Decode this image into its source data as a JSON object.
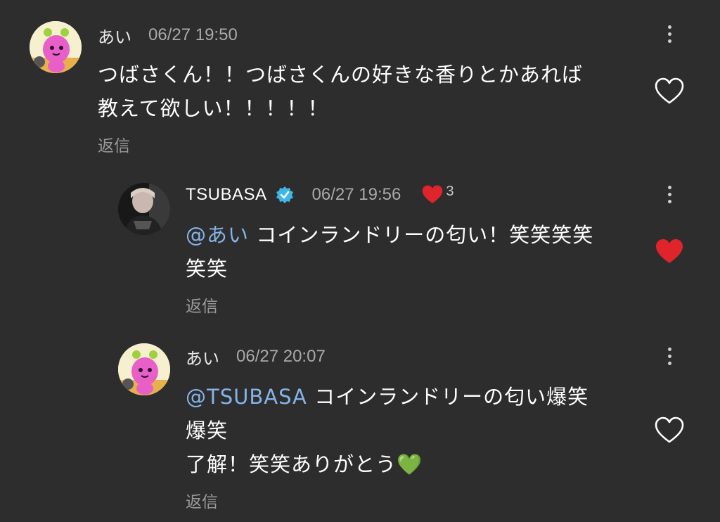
{
  "comments": [
    {
      "username": "あい",
      "timestamp": "06/27 19:50",
      "lines": [
        "つばさくん！！つばさくんの好きな香りとかあれば",
        "教えて欲しい！！！！！"
      ],
      "reply_label": "返信",
      "liked": false,
      "avatar": "pink-character-avatar"
    },
    {
      "username": "TSUBASA",
      "verified": true,
      "timestamp": "06/27 19:56",
      "creator_like_count": "3",
      "mention": "@あい",
      "lines": [
        "コインランドリーの匂い！笑笑笑笑",
        "笑笑"
      ],
      "reply_label": "返信",
      "liked": true,
      "avatar": "photo-avatar"
    },
    {
      "username": "あい",
      "timestamp": "06/27 20:07",
      "mention": "@TSUBASA",
      "lines": [
        "コインランドリーの匂い爆笑",
        "爆笑",
        "了解！笑笑ありがとう💚"
      ],
      "reply_label": "返信",
      "liked": false,
      "avatar": "pink-character-avatar"
    }
  ],
  "colors": {
    "background": "#2d2d2d",
    "mention": "#86b4e8",
    "heart_active": "#e0242c",
    "verified": "#3fb6e6"
  }
}
